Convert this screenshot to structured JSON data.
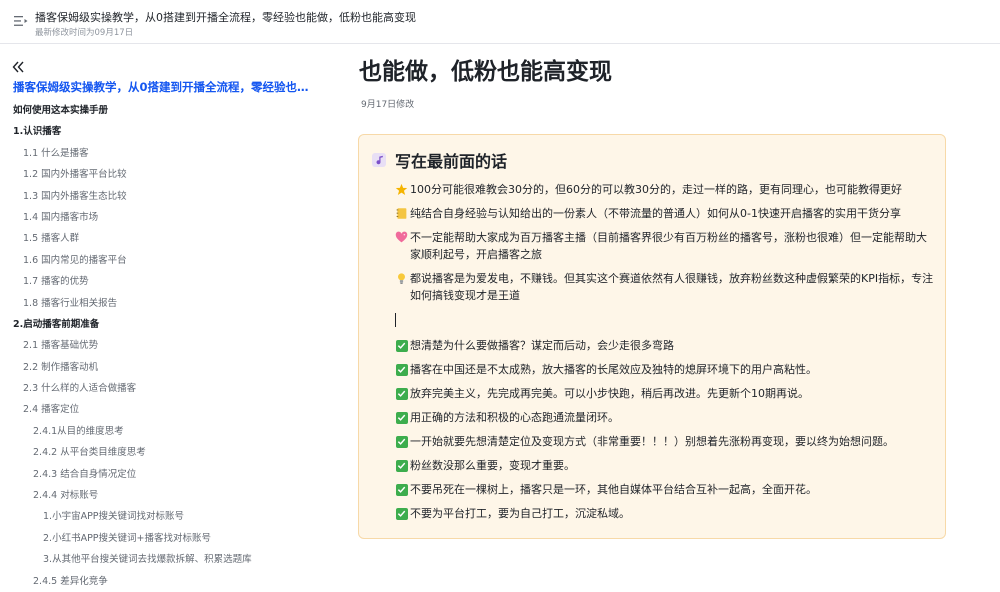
{
  "header": {
    "title": "播客保姆级实操教学，从0搭建到开播全流程，零经验也能做，低粉也能高变现",
    "meta": "最新修改时间为09月17日"
  },
  "sidebar": {
    "toc_title": "播客保姆级实操教学，从0搭建到开播全流程，零经验也能做...",
    "items": [
      {
        "label": "如何使用这本实操手册",
        "level": 1
      },
      {
        "label": "1.认识播客",
        "level": 1
      },
      {
        "label": "1.1 什么是播客",
        "level": 2
      },
      {
        "label": "1.2 国内外播客平台比较",
        "level": 2
      },
      {
        "label": "1.3 国内外播客生态比较",
        "level": 2
      },
      {
        "label": "1.4 国内播客市场",
        "level": 2
      },
      {
        "label": "1.5 播客人群",
        "level": 2
      },
      {
        "label": "1.6 国内常见的播客平台",
        "level": 2
      },
      {
        "label": "1.7 播客的优势",
        "level": 2
      },
      {
        "label": "1.8 播客行业相关报告",
        "level": 2
      },
      {
        "label": "2.启动播客前期准备",
        "level": 1
      },
      {
        "label": "2.1 播客基础优势",
        "level": 2
      },
      {
        "label": "2.2 制作播客动机",
        "level": 2
      },
      {
        "label": "2.3 什么样的人适合做播客",
        "level": 2
      },
      {
        "label": "2.4 播客定位",
        "level": 2
      },
      {
        "label": "2.4.1从目的维度思考",
        "level": 3
      },
      {
        "label": "2.4.2 从平台类目维度思考",
        "level": 3
      },
      {
        "label": "2.4.3 结合自身情况定位",
        "level": 3
      },
      {
        "label": "2.4.4 对标账号",
        "level": 3
      },
      {
        "label": "1.小宇宙APP搜关键词找对标账号",
        "level": 4
      },
      {
        "label": "2.小红书APP搜关键词+播客找对标账号",
        "level": 4
      },
      {
        "label": "3.从其他平台搜关键词去找爆款拆解、积累选题库",
        "level": 4
      },
      {
        "label": "2.4.5 差异化竞争",
        "level": 3
      }
    ]
  },
  "main": {
    "heading": "也能做，低粉也能高变现",
    "modified": "9月17日修改",
    "callout": {
      "title": "写在最前面的话",
      "intro_lines": [
        {
          "icon": "star-icon",
          "text": "100分可能很难教会30分的，但60分的可以教30分的，走过一样的路，更有同理心，也可能教得更好"
        },
        {
          "icon": "notebook-icon",
          "text": "纯结合自身经验与认知给出的一份素人（不带流量的普通人）如何从0-1快速开启播客的实用干货分享"
        },
        {
          "icon": "heart-icon",
          "text": "不一定能帮助大家成为百万播客主播（目前播客界很少有百万粉丝的播客号，涨粉也很难）但一定能帮助大家顺利起号，开启播客之旅"
        },
        {
          "icon": "lightbulb-icon",
          "text": "都说播客是为爱发电，不赚钱。但其实这个赛道依然有人很赚钱，放弃粉丝数这种虚假繁荣的KPI指标，专注如何搞钱变现才是王道"
        }
      ],
      "check_lines": [
        "想清楚为什么要做播客？谋定而后动，会少走很多弯路",
        "播客在中国还是不太成熟，放大播客的长尾效应及独特的熄屏环境下的用户高粘性。",
        "放弃完美主义，先完成再完美。可以小步快跑，稍后再改进。先更新个10期再说。",
        "用正确的方法和积极的心态跑通流量闭环。",
        "一开始就要先想清楚定位及变现方式（非常重要！！！）别想着先涨粉再变现，要以终为始想问题。",
        "粉丝数没那么重要，变现才重要。",
        "不要吊死在一棵树上，播客只是一环，其他自媒体平台结合互补一起高，全面开花。",
        "不要为平台打工，要为自己打工，沉淀私域。"
      ]
    }
  },
  "colors": {
    "accent": "#1456f0",
    "callout_bg": "#fef6e8",
    "callout_border": "#f7d9a8",
    "check": "#3dad4d"
  }
}
